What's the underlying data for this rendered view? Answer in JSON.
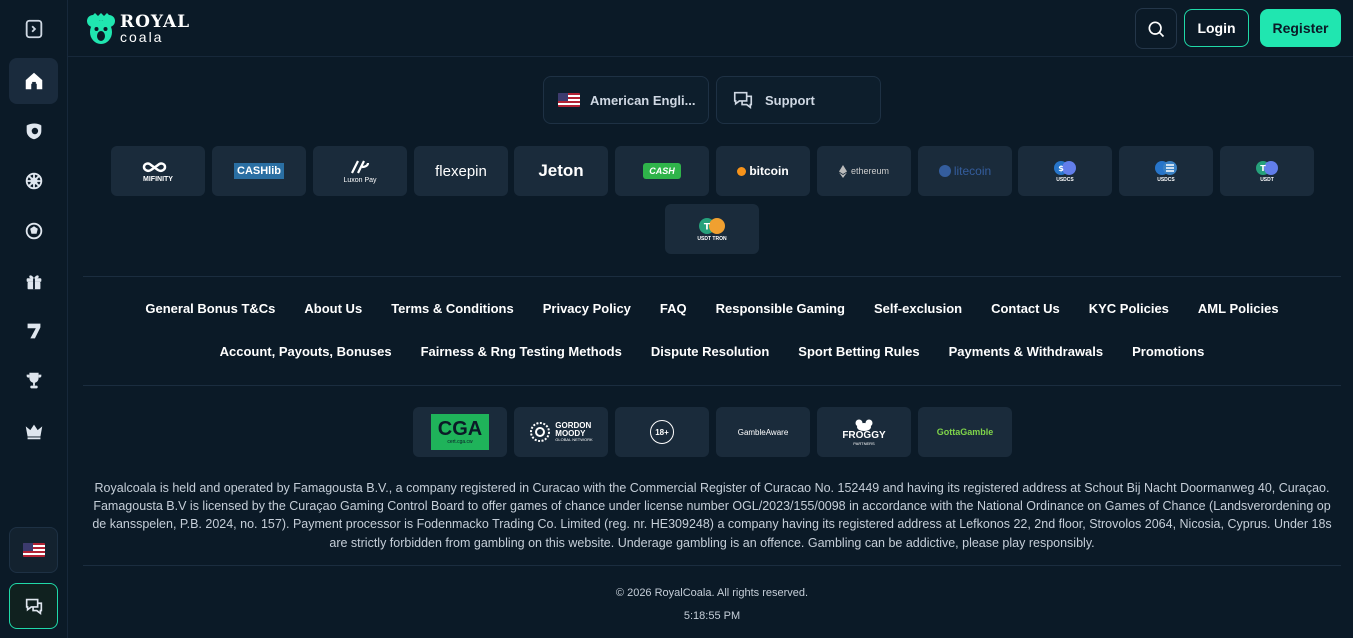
{
  "header": {
    "brand_top": "ROYAL",
    "brand_bottom": "coala",
    "login_label": "Login",
    "register_label": "Register"
  },
  "sidebar": {
    "items": [
      {
        "icon": "sidebar-toggle-icon"
      },
      {
        "icon": "home-icon"
      },
      {
        "icon": "sports-icon"
      },
      {
        "icon": "roulette-icon"
      },
      {
        "icon": "football-icon"
      },
      {
        "icon": "gift-icon"
      },
      {
        "icon": "seven-icon"
      },
      {
        "icon": "trophy-icon"
      },
      {
        "icon": "crown-icon"
      }
    ]
  },
  "language": {
    "label": "American Engli..."
  },
  "support": {
    "label": "Support"
  },
  "payments": {
    "mifinity": "MIFINITY",
    "cashlib": "CASHlib",
    "luxon": "Luxon Pay",
    "flexepin": "flexepin",
    "jeton": "Jeton",
    "bitcoin_cash": "CASH",
    "bitcoin": "bitcoin",
    "ethereum": "ethereum",
    "litecoin": "litecoin",
    "usdc_erc": "USDCS",
    "usdc_sol": "USDCS",
    "usdt_erc": "USDT",
    "usdt_trc": "USDT TRON"
  },
  "footer_links_row1": [
    "General Bonus T&Cs",
    "About Us",
    "Terms & Conditions",
    "Privacy Policy",
    "FAQ",
    "Responsible Gaming",
    "Self-exclusion",
    "Contact Us",
    "KYC Policies",
    "AML Policies"
  ],
  "footer_links_row2": [
    "Account, Payouts, Bonuses",
    "Fairness & Rng Testing Methods",
    "Dispute Resolution",
    "Sport Betting Rules",
    "Payments & Withdrawals",
    "Promotions"
  ],
  "badges": {
    "cga": "CGA",
    "cga_sub": "cert.cga.cw",
    "gordon_1": "GORDON",
    "gordon_2": "MOODY",
    "gordon_3": "GLOBAL NETWORK",
    "age": "18+",
    "gambleaware": "GambleAware",
    "froggy": "FROGGY",
    "froggy_sub": "PARTNERS",
    "gotogamble": "GottaGamble"
  },
  "legal_text": "Royalcoala is held and operated by Famagousta B.V., a company registered in Curacao with the Commercial Register of Curacao No. 152449 and having its registered address at Schout Bij Nacht Doormanweg 40, Curaçao. Famagousta B.V is licensed by the Curaçao Gaming Control Board to offer games of chance under license number OGL/2023/155/0098 in accordance with the National Ordinance on Games of Chance (Landsverordening op de kansspelen, P.B. 2024, no. 157). Payment processor is Fodenmacko Trading Co. Limited (reg. nr. HE309248) a company having its registered address at Lefkonos 22, 2nd floor, Strovolos 2064, Nicosia, Cyprus. Under 18s are strictly forbidden from gambling on this website. Underage gambling is an offence. Gambling can be addictive, please play responsibly.",
  "copyright": "© 2026 RoyalCoala. All rights reserved.",
  "clock": "5:18:55 PM",
  "colors": {
    "accent": "#20e6b0",
    "background": "#0b1a27",
    "tile": "#1a2b3b"
  }
}
